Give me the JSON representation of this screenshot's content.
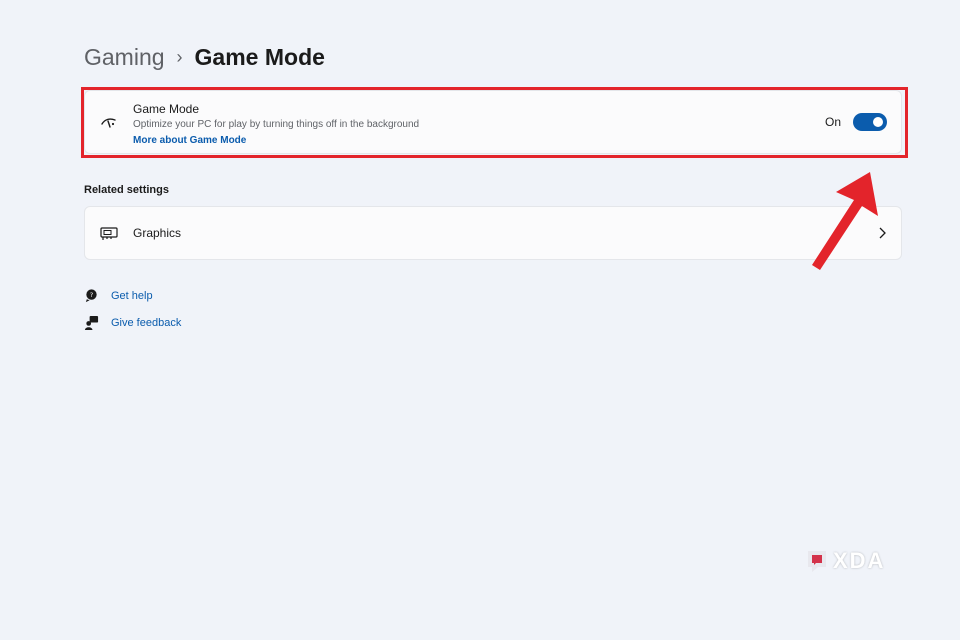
{
  "breadcrumb": {
    "parent": "Gaming",
    "separator": "›",
    "current": "Game Mode"
  },
  "game_mode": {
    "icon": "game-mode-icon",
    "title": "Game Mode",
    "description": "Optimize your PC for play by turning things off in the background",
    "link": "More about Game Mode",
    "toggle_state_label": "On",
    "toggle_on": true
  },
  "related_settings": {
    "heading": "Related settings",
    "items": [
      {
        "icon": "graphics-card-icon",
        "label": "Graphics"
      }
    ]
  },
  "help_links": {
    "get_help": "Get help",
    "give_feedback": "Give feedback"
  },
  "annotation": {
    "highlight_color": "#e3242b",
    "arrow_color": "#e3242b"
  },
  "watermark": {
    "text": "XDA"
  },
  "colors": {
    "background": "#f0f3f9",
    "card": "#fbfbfc",
    "accent": "#0b5cad"
  }
}
